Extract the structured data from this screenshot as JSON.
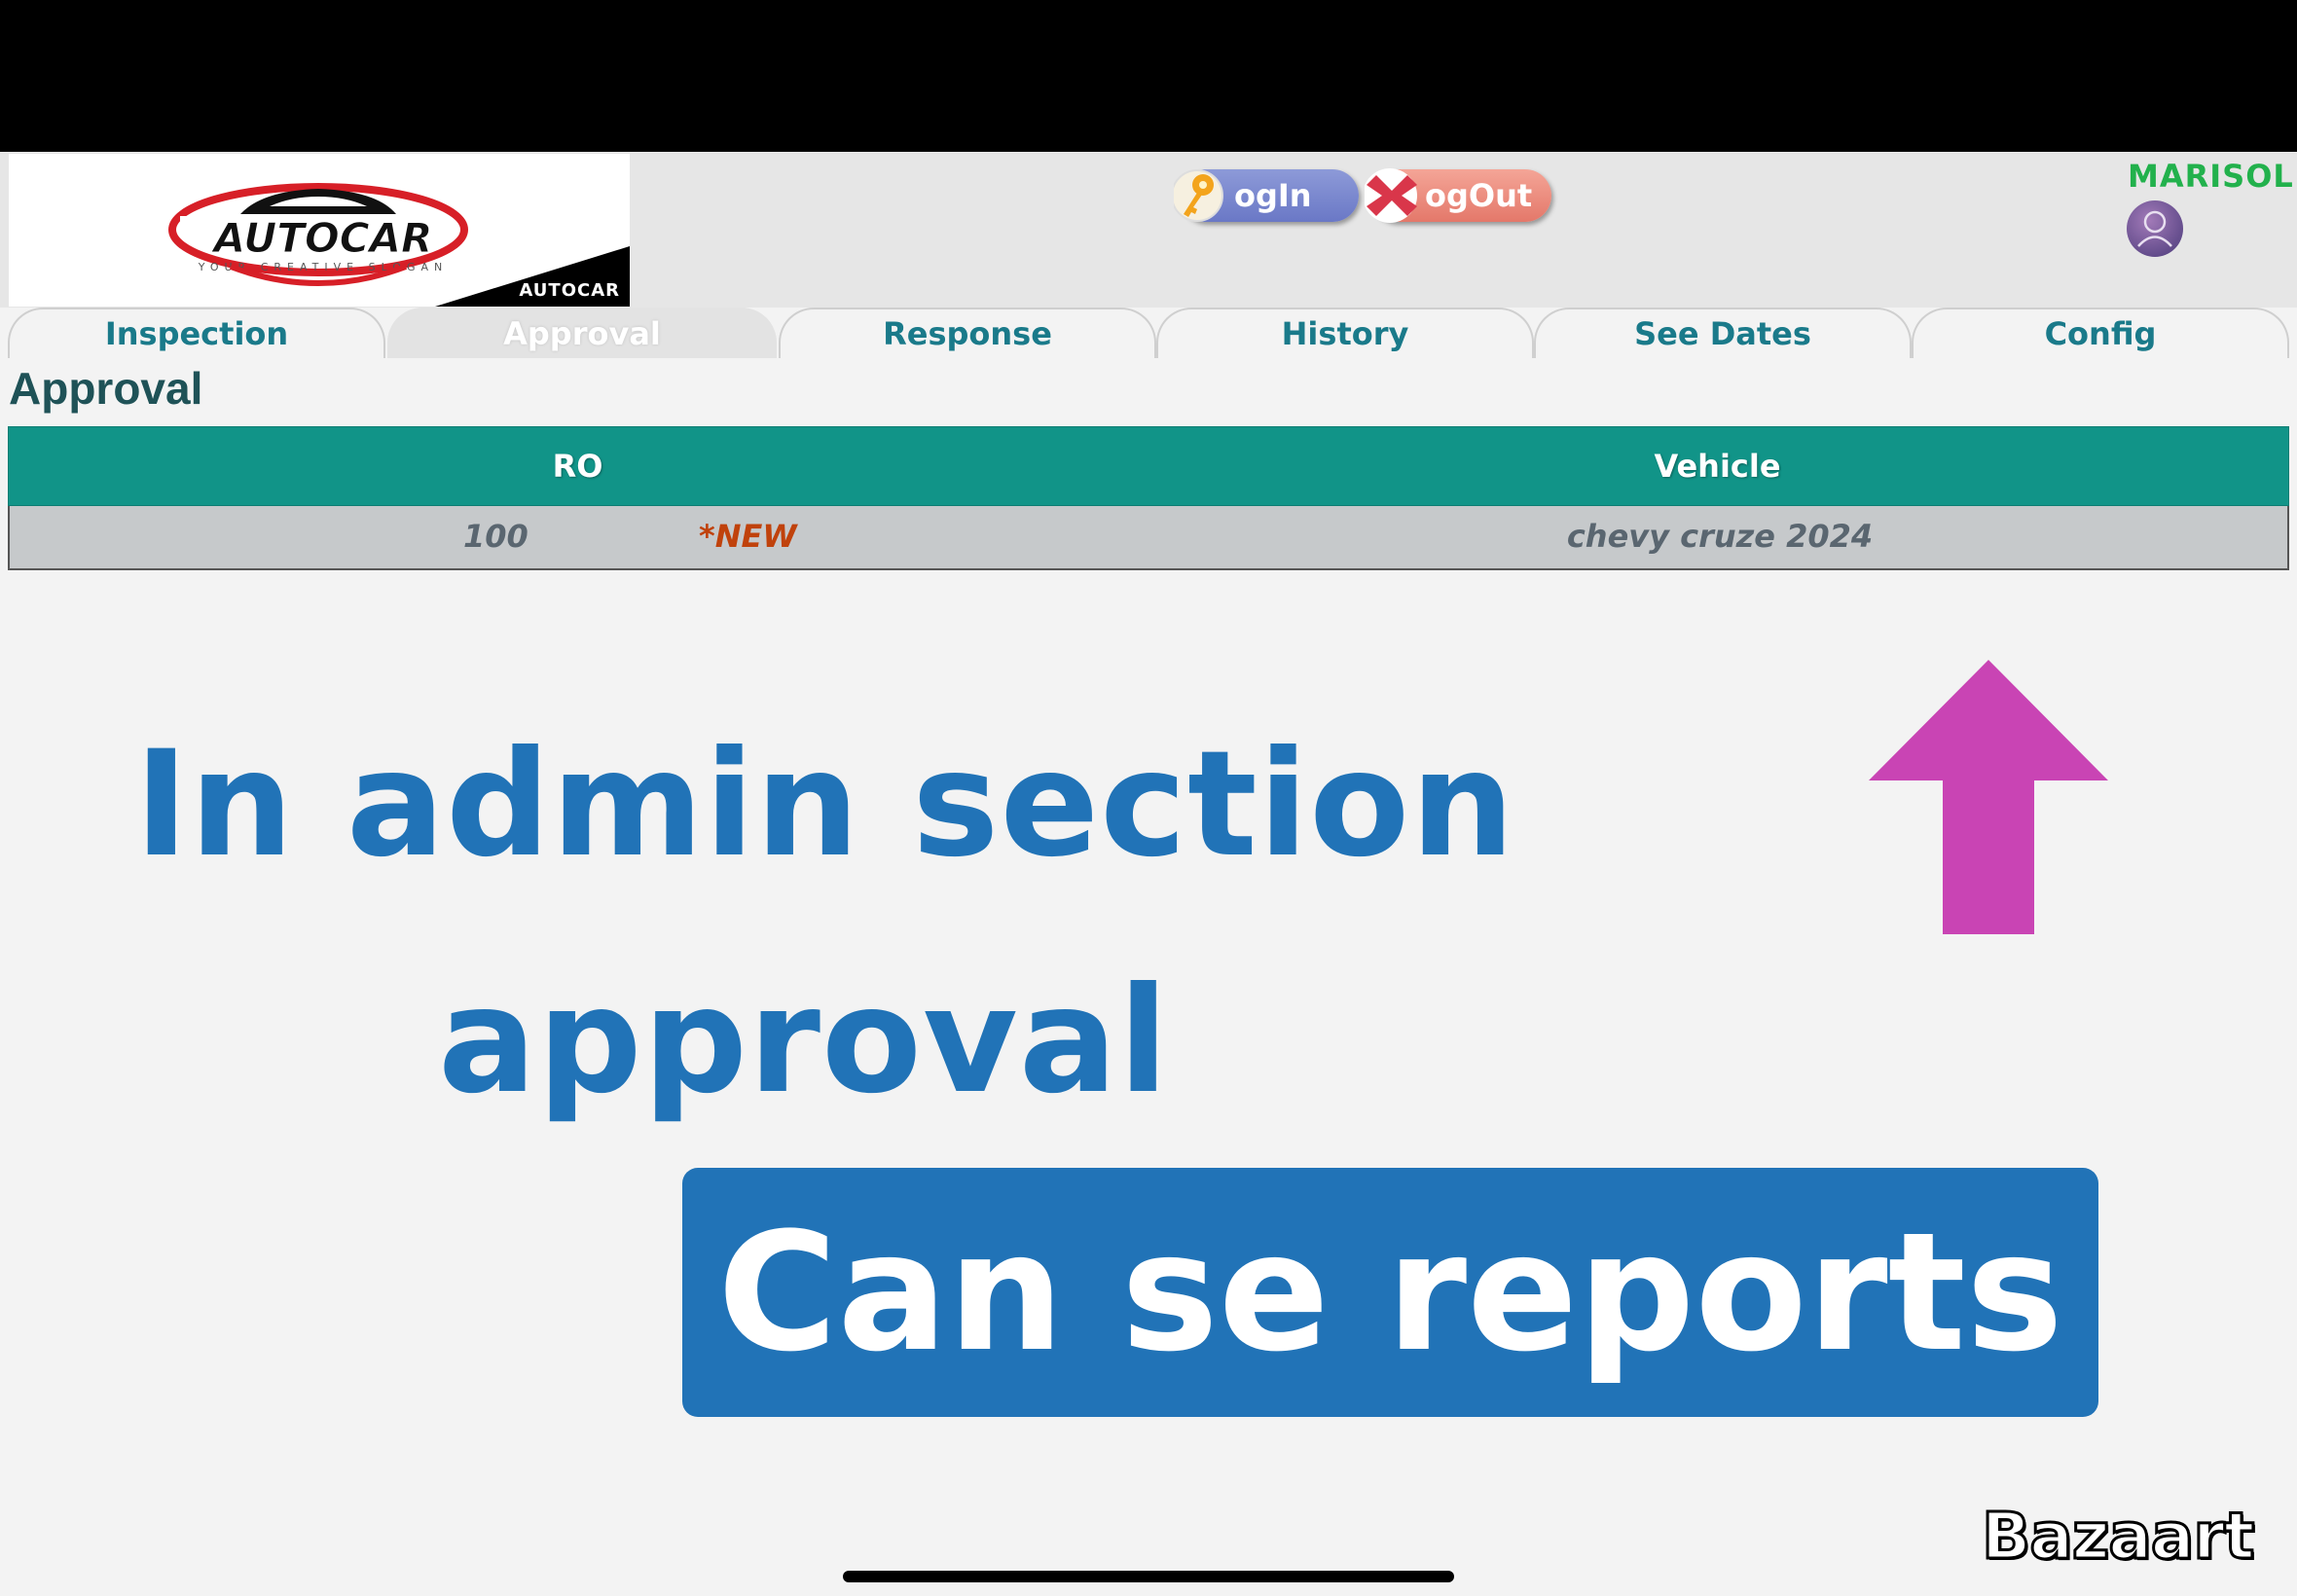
{
  "header": {
    "logo": {
      "brand": "AUTOCAR",
      "slogan": "YOUR CREATIVE SLOGAN",
      "corner_brand": "AUTOCAR"
    },
    "login_label": "ogIn",
    "logout_label": "ogOut",
    "username": "MARISOL"
  },
  "tabs": [
    {
      "label": "Inspection",
      "active": false
    },
    {
      "label": "Approval",
      "active": true
    },
    {
      "label": "Response",
      "active": false
    },
    {
      "label": "History",
      "active": false
    },
    {
      "label": "See Dates",
      "active": false
    },
    {
      "label": "Config",
      "active": false
    }
  ],
  "page_title": "Approval",
  "grid": {
    "headers": [
      "RO",
      "Vehicle"
    ],
    "rows": [
      {
        "ro": "100",
        "badge": "*NEW",
        "vehicle": "chevy cruze 2024"
      }
    ]
  },
  "overlay": {
    "line1": "In admin section",
    "line2": "approval",
    "highlight": "Can se reports",
    "arrow_color": "#c944b4",
    "text_color": "#2173b7"
  },
  "watermark": "Bazaart",
  "colors": {
    "header_green": "#119488",
    "tab_text": "#1a7a8a",
    "username": "#22b14c",
    "new_badge": "#c0420c"
  }
}
